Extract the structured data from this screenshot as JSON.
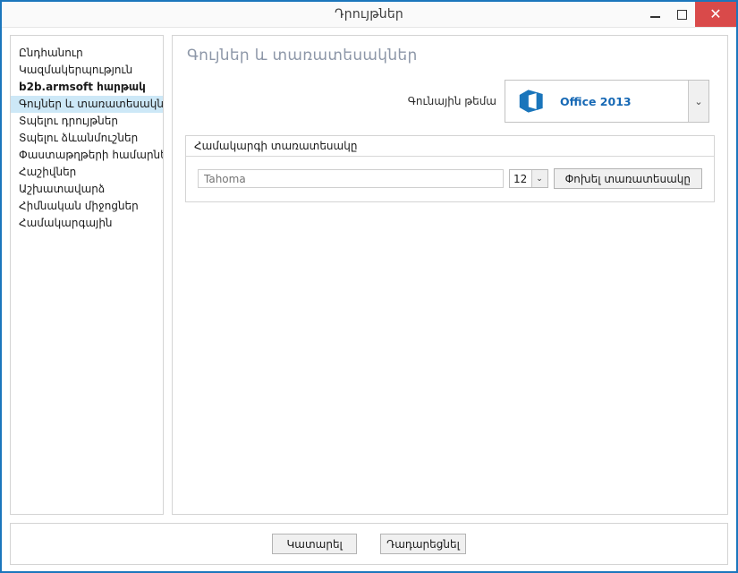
{
  "window": {
    "title": "Դրույթներ",
    "controls": {
      "minimize": "—",
      "maximize": "▢",
      "close": "✕"
    },
    "border_color": "#1b76bc",
    "close_color": "#d94a4a"
  },
  "sidebar": {
    "items": [
      {
        "label": "Ընդհանուր",
        "selected": false,
        "bold": false
      },
      {
        "label": "Կազմակերպություն",
        "selected": false,
        "bold": false
      },
      {
        "label": "b2b.armsoft հարթակ",
        "selected": false,
        "bold": true
      },
      {
        "label": "Գույներ և տառատեսակներ",
        "selected": true,
        "bold": false
      },
      {
        "label": "Տպելու դրույթներ",
        "selected": false,
        "bold": false
      },
      {
        "label": "Տպելու ձևանմուշներ",
        "selected": false,
        "bold": false
      },
      {
        "label": "Փաստաթղթերի համարներ",
        "selected": false,
        "bold": false
      },
      {
        "label": "Հաշիվներ",
        "selected": false,
        "bold": false
      },
      {
        "label": "Աշխատավարձ",
        "selected": false,
        "bold": false
      },
      {
        "label": "Հիմնական միջոցներ",
        "selected": false,
        "bold": false
      },
      {
        "label": "Համակարգային",
        "selected": false,
        "bold": false
      }
    ],
    "selected_highlight": "#cde8f7"
  },
  "main": {
    "page_title": "Գույներ և տառատեսակներ",
    "theme": {
      "label": "Գունային թեմա",
      "selected": "Office 2013",
      "icon": "office-logo-icon",
      "accent_color": "#1769b5",
      "arrow": "⌄"
    },
    "font_group": {
      "header": "Համակարգի տառատեսակը",
      "font_field_value": "Tahoma",
      "font_field_placeholder": "Tahoma",
      "size_value": "12",
      "size_arrow": "⌄",
      "change_button": "Փոխել տառատեսակը"
    }
  },
  "footer": {
    "ok_label": "Կատարել",
    "cancel_label": "Դադարեցնել"
  }
}
